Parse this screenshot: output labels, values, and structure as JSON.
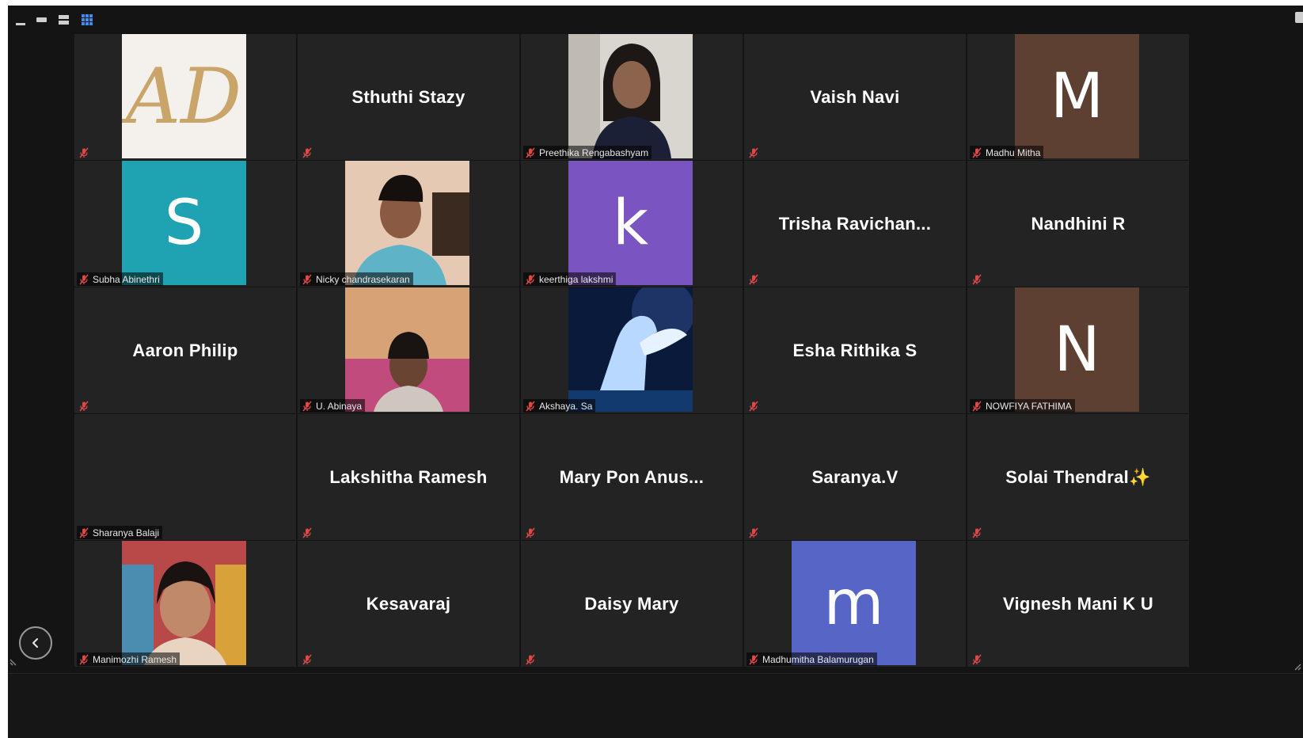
{
  "toolbar": {
    "view_buttons": [
      "minimize-view",
      "thumbnail-strip-view",
      "speaker-view",
      "gallery-view"
    ]
  },
  "colors": {
    "window_bg": "#141414",
    "tile_bg": "#232323",
    "muted_mic": "#e04848",
    "avatar_brown": "#5e4033",
    "avatar_teal": "#1fa2b1",
    "avatar_purple": "#7a55c2",
    "avatar_blue": "#5665c6"
  },
  "participants": [
    {
      "display": "AD",
      "kind": "logo",
      "name": ""
    },
    {
      "display": "Sthuthi Stazy",
      "kind": "text",
      "name": ""
    },
    {
      "display": "",
      "kind": "video",
      "name": "Preethika Rengabashyam"
    },
    {
      "display": "Vaish Navi",
      "kind": "text",
      "name": ""
    },
    {
      "display": "M",
      "kind": "avatar",
      "color": "#5e4033",
      "name": "Madhu Mitha"
    },
    {
      "display": "S",
      "kind": "avatar",
      "color": "#1fa2b1",
      "name": "Subha Abinethri"
    },
    {
      "display": "",
      "kind": "video",
      "name": "Nicky chandrasekaran"
    },
    {
      "display": "k",
      "kind": "avatar",
      "color": "#7a55c2",
      "name": "keerthiga lakshmi"
    },
    {
      "display": "Trisha  Ravichan...",
      "kind": "text",
      "name": ""
    },
    {
      "display": "Nandhini R",
      "kind": "text",
      "name": ""
    },
    {
      "display": "Aaron Philip",
      "kind": "text",
      "name": ""
    },
    {
      "display": "",
      "kind": "video",
      "name": "U. Abinaya"
    },
    {
      "display": "",
      "kind": "image",
      "name": "Akshaya. Sa"
    },
    {
      "display": "Esha Rithika S",
      "kind": "text",
      "name": ""
    },
    {
      "display": "N",
      "kind": "avatar",
      "color": "#5e4033",
      "name": "NOWFIYA FATHIMA"
    },
    {
      "display": "",
      "kind": "blank",
      "name": "Sharanya Balaji"
    },
    {
      "display": "Lakshitha Ramesh",
      "kind": "text",
      "name": ""
    },
    {
      "display": "Mary  Pon  Anus...",
      "kind": "text",
      "name": ""
    },
    {
      "display": "Saranya.V",
      "kind": "text",
      "name": ""
    },
    {
      "display": "Solai  Thendral✨",
      "kind": "text",
      "name": ""
    },
    {
      "display": "",
      "kind": "video",
      "name": "Manimozhi Ramesh"
    },
    {
      "display": "Kesavaraj",
      "kind": "text",
      "name": ""
    },
    {
      "display": "Daisy Mary",
      "kind": "text",
      "name": ""
    },
    {
      "display": "m",
      "kind": "avatar",
      "color": "#5665c6",
      "name": "Madhumitha Balamurugan"
    },
    {
      "display": "Vignesh Mani K U",
      "kind": "text",
      "name": ""
    }
  ]
}
